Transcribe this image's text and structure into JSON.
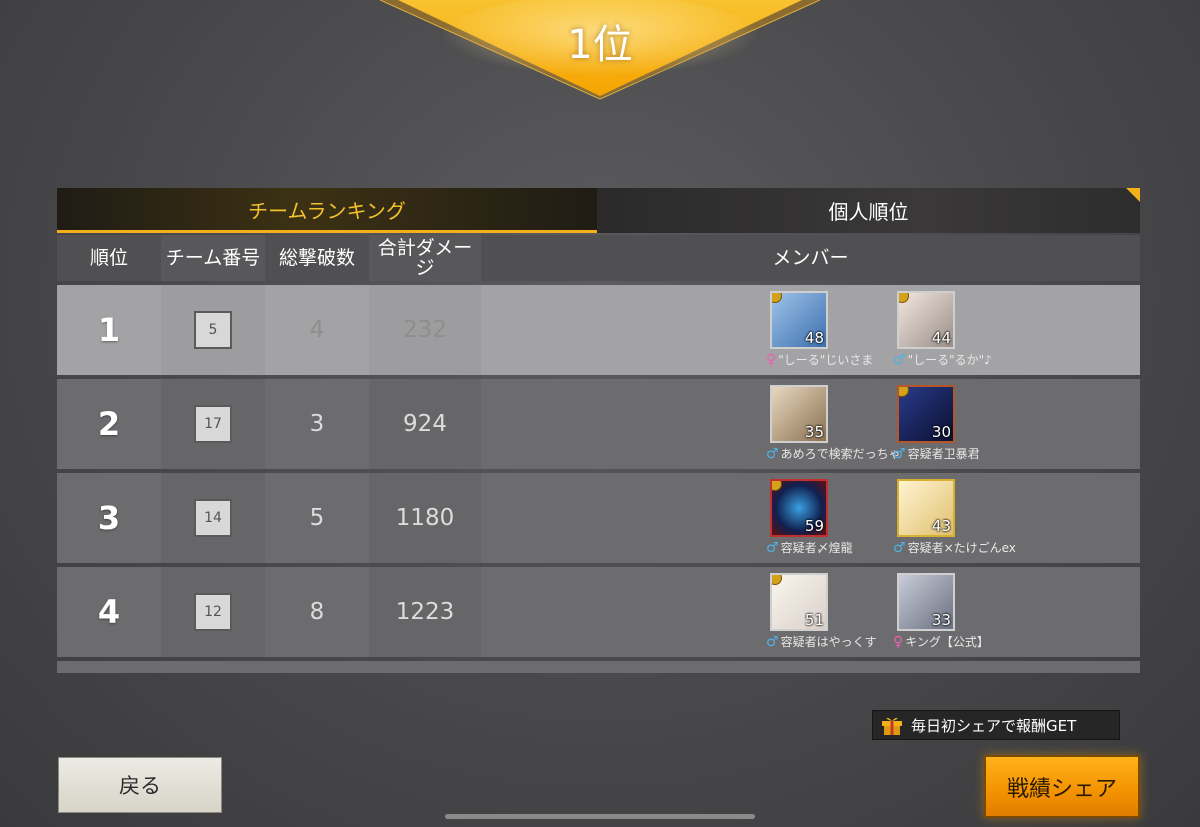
{
  "result": {
    "rank_label": "1位"
  },
  "tabs": {
    "team": "チームランキング",
    "personal": "個人順位"
  },
  "columns": {
    "rank": "順位",
    "team_no": "チーム番号",
    "kills": "総撃破数",
    "damage": "合計ダメージ",
    "members": "メンバー"
  },
  "rows": [
    {
      "rank": "1",
      "team": "5",
      "kills": "4",
      "damage": "232",
      "members": [
        {
          "name": "\"しーる\"じいさま",
          "level": "48",
          "gender": "♀"
        },
        {
          "name": "\"しーる\"るか\"♪",
          "level": "44",
          "gender": "♂"
        }
      ]
    },
    {
      "rank": "2",
      "team": "17",
      "kills": "3",
      "damage": "924",
      "members": [
        {
          "name": "あめろで検索だっちゃ",
          "level": "35",
          "gender": "♂"
        },
        {
          "name": "容疑者卫暴君",
          "level": "30",
          "gender": "♂"
        }
      ]
    },
    {
      "rank": "3",
      "team": "14",
      "kills": "5",
      "damage": "1180",
      "members": [
        {
          "name": "容疑者〆煌龍",
          "level": "59",
          "gender": "♂"
        },
        {
          "name": "容疑者×たけごんex",
          "level": "43",
          "gender": "♂"
        }
      ]
    },
    {
      "rank": "4",
      "team": "12",
      "kills": "8",
      "damage": "1223",
      "members": [
        {
          "name": "容疑者はやっくす",
          "level": "51",
          "gender": "♂"
        },
        {
          "name": "キング【公式】",
          "level": "33",
          "gender": "♀"
        }
      ]
    }
  ],
  "share_tip": "毎日初シェアで報酬GET",
  "buttons": {
    "back": "戻る",
    "share": "戦績シェア"
  },
  "colors": {
    "accent_gold": "#f4b018",
    "male": "#4fb2e6",
    "female": "#ee5fb0"
  }
}
